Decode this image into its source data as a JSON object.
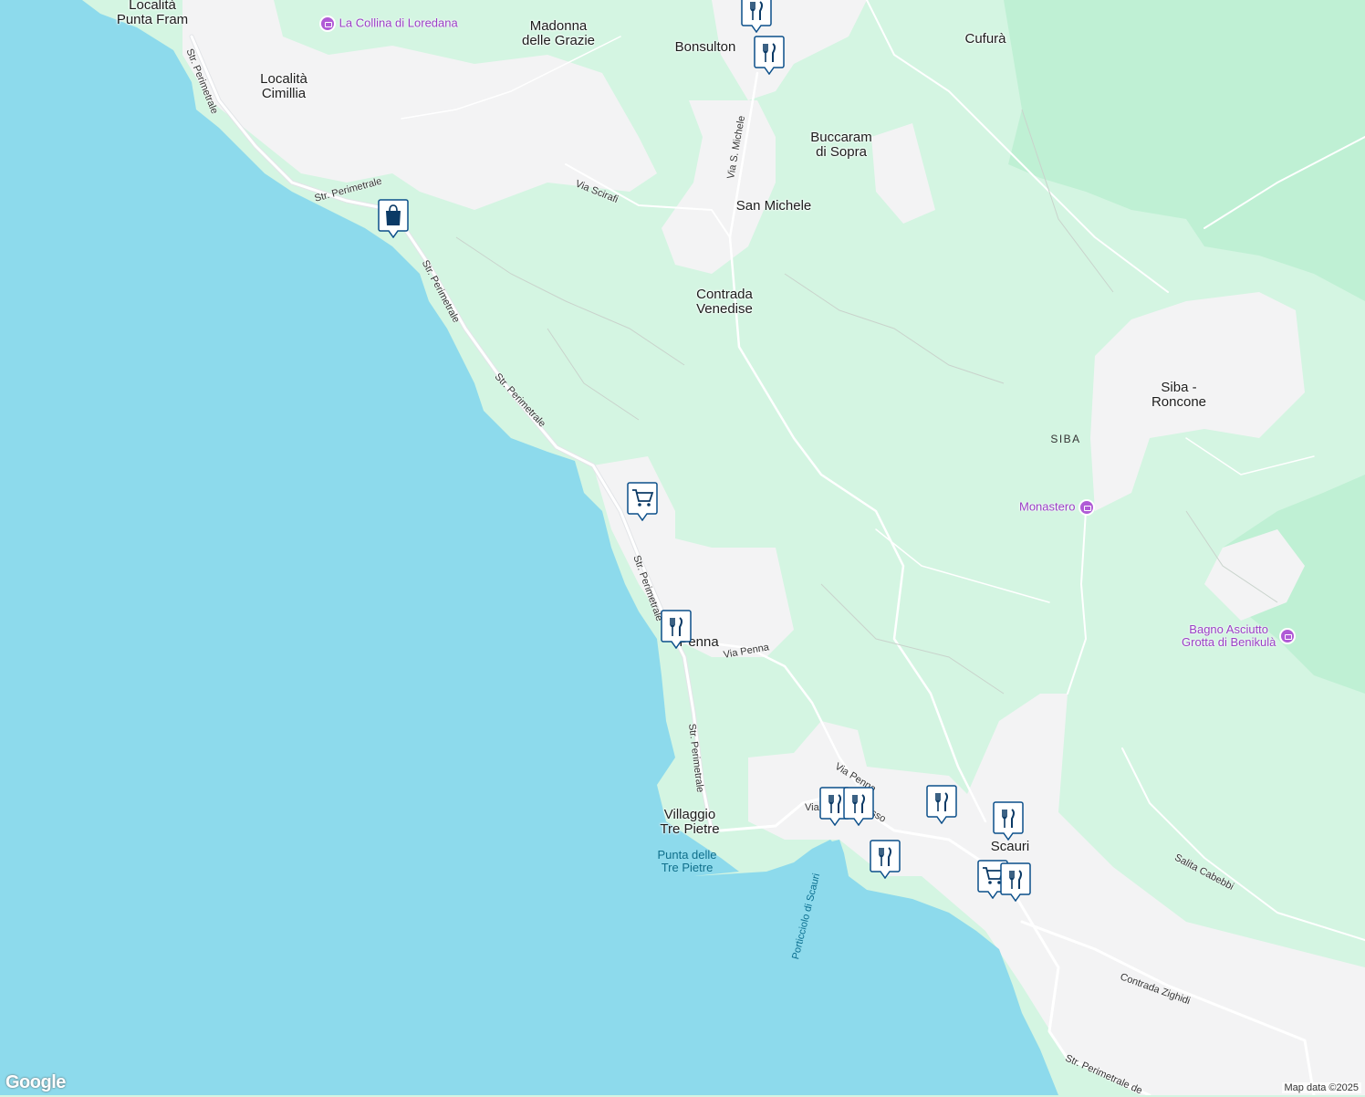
{
  "map": {
    "attribution": "Map data ©2025",
    "logo": "Google",
    "colors": {
      "sea": "#8ddaec",
      "land": "#d4f5e2",
      "urban": "#f3f3f4",
      "forest": "#bff0d4",
      "road": "#ffffff",
      "poi": "#b05ad6",
      "pin": "#0b4f8a"
    }
  },
  "places": [
    {
      "id": "punta-fram",
      "name": "Località\nPunta Fram"
    },
    {
      "id": "cimillia",
      "name": "Località\nCimillia"
    },
    {
      "id": "madonna",
      "name": "Madonna\ndelle Grazie"
    },
    {
      "id": "bonsulton",
      "name": "Bonsulton"
    },
    {
      "id": "cufura",
      "name": "Cufurà"
    },
    {
      "id": "buccaram",
      "name": "Buccaram\ndi Sopra"
    },
    {
      "id": "san-michele",
      "name": "San Michele"
    },
    {
      "id": "venedise",
      "name": "Contrada\nVenedise"
    },
    {
      "id": "siba-roncone",
      "name": "Siba -\nRoncone"
    },
    {
      "id": "penna",
      "name": "Penna"
    },
    {
      "id": "villaggio",
      "name": "Villaggio\nTre Pietre"
    },
    {
      "id": "scauri",
      "name": "Scauri"
    }
  ],
  "regions": [
    {
      "id": "siba",
      "name": "SIBA"
    }
  ],
  "pois": [
    {
      "id": "collina",
      "name": "La Collina di Loredana",
      "icon": "museum-icon"
    },
    {
      "id": "monastero",
      "name": "Monastero",
      "icon": "camera-icon"
    },
    {
      "id": "bagno",
      "name": "Bagno Asciutto\nGrotta di Benikulà",
      "icon": "camera-icon"
    }
  ],
  "roads": [
    {
      "id": "r1",
      "name": "Str. Perimetrale"
    },
    {
      "id": "r2",
      "name": "Str. Perimetrale"
    },
    {
      "id": "r3",
      "name": "Str. Perimetrale"
    },
    {
      "id": "r4",
      "name": "Str. Perimetrale"
    },
    {
      "id": "r5",
      "name": "Str. Perimetrale"
    },
    {
      "id": "r6",
      "name": "Str. Perimetrale"
    },
    {
      "id": "r7",
      "name": "Via Scirafi"
    },
    {
      "id": "r8",
      "name": "Via S. Michele"
    },
    {
      "id": "r9",
      "name": "Via Penna"
    },
    {
      "id": "r10",
      "name": "Via Penna"
    },
    {
      "id": "r11",
      "name": "Via"
    },
    {
      "id": "r12",
      "name": "sso"
    },
    {
      "id": "r13",
      "name": "Salita Cabebbi"
    },
    {
      "id": "r14",
      "name": "Contrada Zighidi"
    },
    {
      "id": "r15",
      "name": "Str. Perimetrale de"
    }
  ],
  "water_labels": [
    {
      "id": "cape",
      "name": "Punta delle\nTre Pietre"
    },
    {
      "id": "porticciolo",
      "name": "Porticciolo di Scauri"
    }
  ],
  "markers": [
    {
      "id": "m1",
      "icon": "restaurant-icon"
    },
    {
      "id": "m2",
      "icon": "restaurant-icon"
    },
    {
      "id": "m3",
      "icon": "shopping-bag-icon"
    },
    {
      "id": "m4",
      "icon": "shopping-cart-icon"
    },
    {
      "id": "m5",
      "icon": "restaurant-icon"
    },
    {
      "id": "m6",
      "icon": "restaurant-icon"
    },
    {
      "id": "m7",
      "icon": "restaurant-icon"
    },
    {
      "id": "m8",
      "icon": "restaurant-icon"
    },
    {
      "id": "m9",
      "icon": "restaurant-icon"
    },
    {
      "id": "m10",
      "icon": "restaurant-icon"
    },
    {
      "id": "m11",
      "icon": "shopping-cart-icon"
    },
    {
      "id": "m12",
      "icon": "restaurant-icon"
    }
  ]
}
